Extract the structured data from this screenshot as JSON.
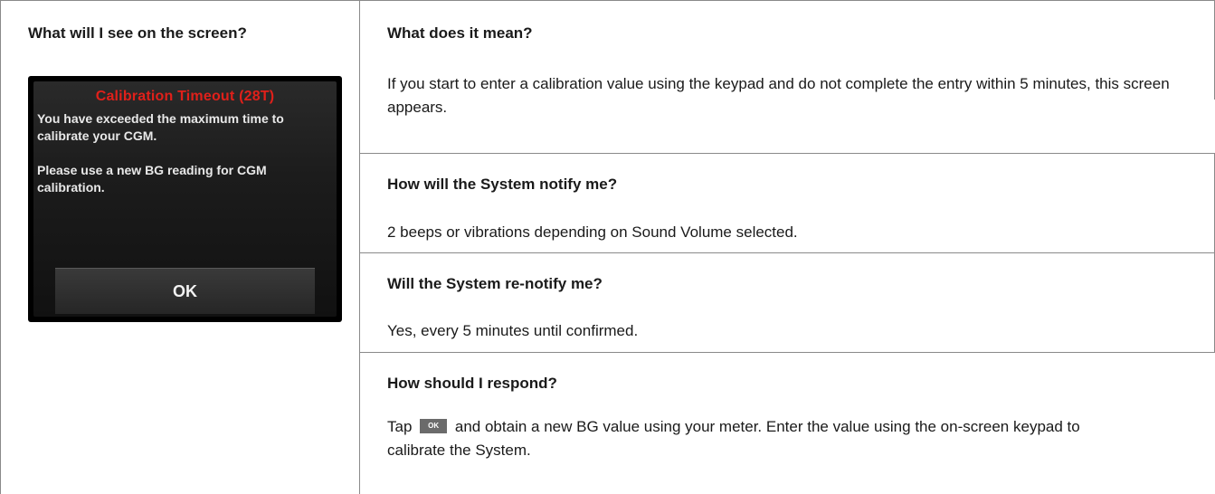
{
  "left": {
    "heading": "What will I see on the screen?",
    "screen": {
      "title": "Calibration Timeout (28T)",
      "message_line1": "You have exceeded the maximum time to calibrate your CGM.",
      "message_line2": "Please use a new BG reading for CGM calibration.",
      "ok_label": "OK"
    }
  },
  "sections": {
    "meaning": {
      "title": "What does it mean?",
      "body": "If you start to enter a calibration value using the keypad and do not complete the entry within 5 minutes, this screen appears."
    },
    "notify": {
      "title": "How will the System notify me?",
      "body": "2 beeps or vibrations depending on Sound Volume selected."
    },
    "renotify": {
      "title": "Will the System re-notify me?",
      "body": "Yes, every 5 minutes until confirmed."
    },
    "respond": {
      "title": "How should I respond?",
      "body_before": "Tap",
      "ok_chip": "OK",
      "body_after": "and obtain a new BG value using your meter. Enter the value using the on-screen keypad to calibrate the System."
    }
  },
  "colors": {
    "timeout_title": "#e0201a",
    "border": "#8a8a8a"
  }
}
